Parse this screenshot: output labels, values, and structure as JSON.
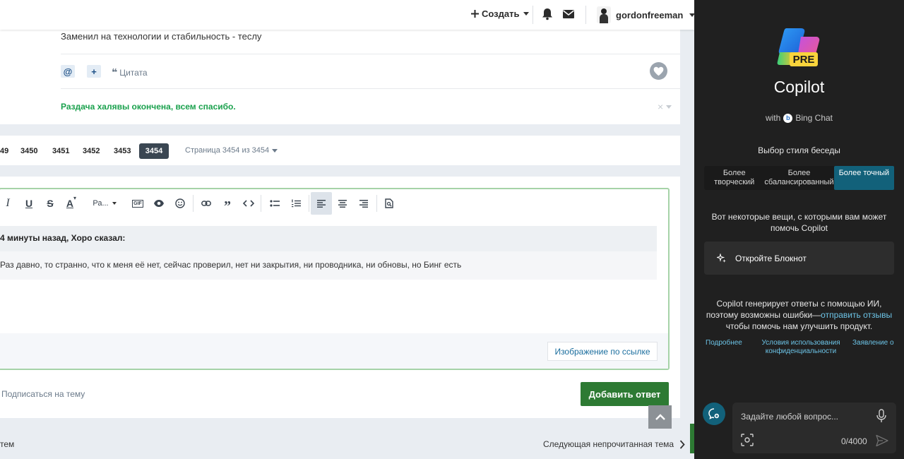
{
  "topbar": {
    "create_label": "Создать",
    "username": "gordonfreeman"
  },
  "post": {
    "text": "Заменил на технологии и стабильность - теслу",
    "mention_label": "@",
    "plus_label": "+",
    "quote_label": "Цитата",
    "giveaway_notice": "Раздача халявы окончена, всем спасибо.",
    "dismiss_label": "×"
  },
  "pagination": {
    "pages": [
      "49",
      "3450",
      "3451",
      "3452",
      "3453",
      "3454"
    ],
    "current": "3454",
    "page_info": "Страница 3454 из 3454"
  },
  "editor": {
    "font_label": "Ра...",
    "quote_header": "4 минуты назад, Хоро сказал:",
    "quote_body": "Раз давно, то странно, что к меня её нет, сейчас проверил, нет ни закрытия, ни проводника, ни обновы, но Бинг есть",
    "image_link_label": "Изображение по ссылке"
  },
  "reply": {
    "subscribe_label": "Подписаться на тему",
    "add_reply_label": "Добавить ответ"
  },
  "bottom_nav": {
    "left_label": "тем",
    "next_unread_label": "Следующая непрочитанная тема"
  },
  "copilot": {
    "badge": "PRE",
    "title": "Copilot",
    "with_label": "with",
    "bing_label": "Bing Chat",
    "style_title": "Выбор стиля беседы",
    "styles": [
      {
        "label": "Более творческий"
      },
      {
        "label": "Более сбалансированный"
      },
      {
        "label": "Более точный"
      }
    ],
    "help_text": "Вот некоторые вещи, с которыми вам может помочь Copilot",
    "notebook_label": "Откройте Блокнот",
    "disclaimer_pre": "Copilot генерирует ответы с помощью ИИ, поэтому возможны ошибки—",
    "disclaimer_link": "отправить отзывы",
    "disclaimer_post": " чтобы помочь нам улучшить продукт.",
    "links": [
      "Подробнее",
      "Условия использования конфиденциальности",
      "Заявление о"
    ],
    "input_placeholder": "Задайте любой вопрос...",
    "char_counter": "0/4000"
  },
  "colors": {
    "accent_green": "#2d7a33",
    "giveaway_green": "#1aa14d",
    "copilot_bg": "#202020",
    "copilot_accent": "#12617a",
    "link_blue": "#6cc3e6"
  }
}
